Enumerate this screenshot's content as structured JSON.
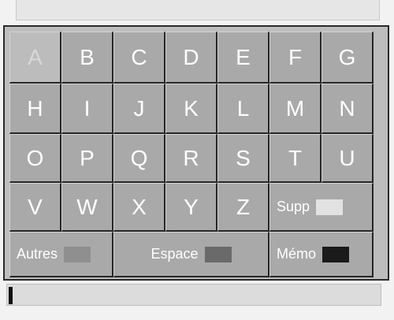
{
  "rows": [
    [
      "A",
      "B",
      "C",
      "D",
      "E",
      "F",
      "G"
    ],
    [
      "H",
      "I",
      "J",
      "K",
      "L",
      "M",
      "N"
    ],
    [
      "O",
      "P",
      "Q",
      "R",
      "S",
      "T",
      "U"
    ],
    [
      "V",
      "W",
      "X",
      "Y",
      "Z"
    ]
  ],
  "selected_key": "A",
  "keys": {
    "supp": "Supp",
    "autres": "Autres",
    "espace": "Espace",
    "memo": "Mémo"
  },
  "colors": {
    "key_bg": "#a9a9a9",
    "selected_bg": "#bcbcbc",
    "supp_swatch": "#e2e2e2",
    "autres_swatch": "#8f8f8f",
    "espace_swatch": "#6a6a6a",
    "memo_swatch": "#1a1a1a"
  },
  "input": {
    "value": ""
  }
}
